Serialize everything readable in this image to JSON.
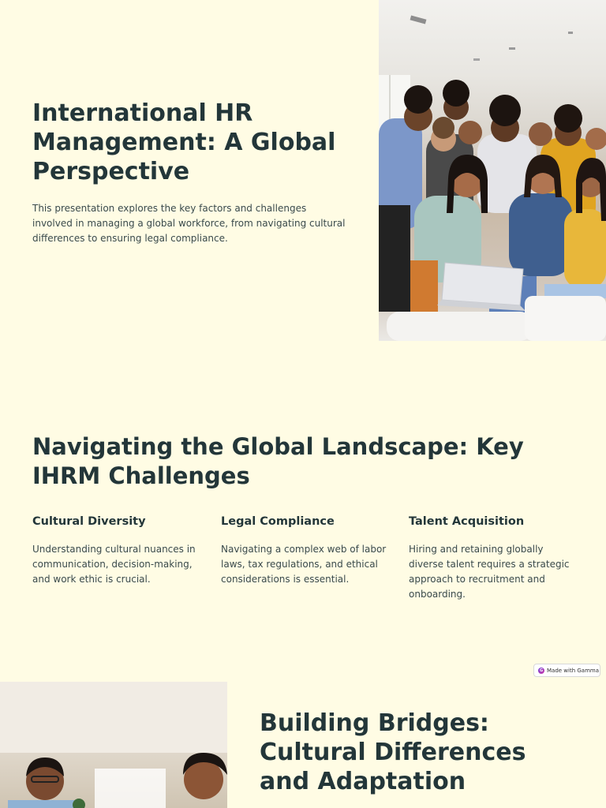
{
  "slide1": {
    "title": "International HR Management: A Global Perspective",
    "description": "This presentation explores the key factors and challenges involved in managing a global workforce, from navigating cultural differences to ensuring legal compliance.",
    "image_icon": "group-photo-icon"
  },
  "slide2": {
    "title": "Navigating the Global Landscape: Key IHRM Challenges",
    "cards": [
      {
        "title": "Cultural Diversity",
        "text": "Understanding cultural nuances in communication, decision-making, and work ethic is crucial."
      },
      {
        "title": "Legal Compliance",
        "text": "Navigating a complex web of labor laws, tax regulations, and ethical considerations is essential."
      },
      {
        "title": "Talent Acquisition",
        "text": "Hiring and retaining globally diverse talent requires a strategic approach to recruitment and onboarding."
      }
    ]
  },
  "badge": {
    "label": "Made with Gamma",
    "logo": "G"
  },
  "slide3": {
    "title": "Building Bridges: Cultural Differences and Adaptation",
    "image_icon": "meeting-photo-icon"
  },
  "colors": {
    "background": "#fffce4",
    "heading": "#233639",
    "body_text": "#3a4a4c"
  }
}
